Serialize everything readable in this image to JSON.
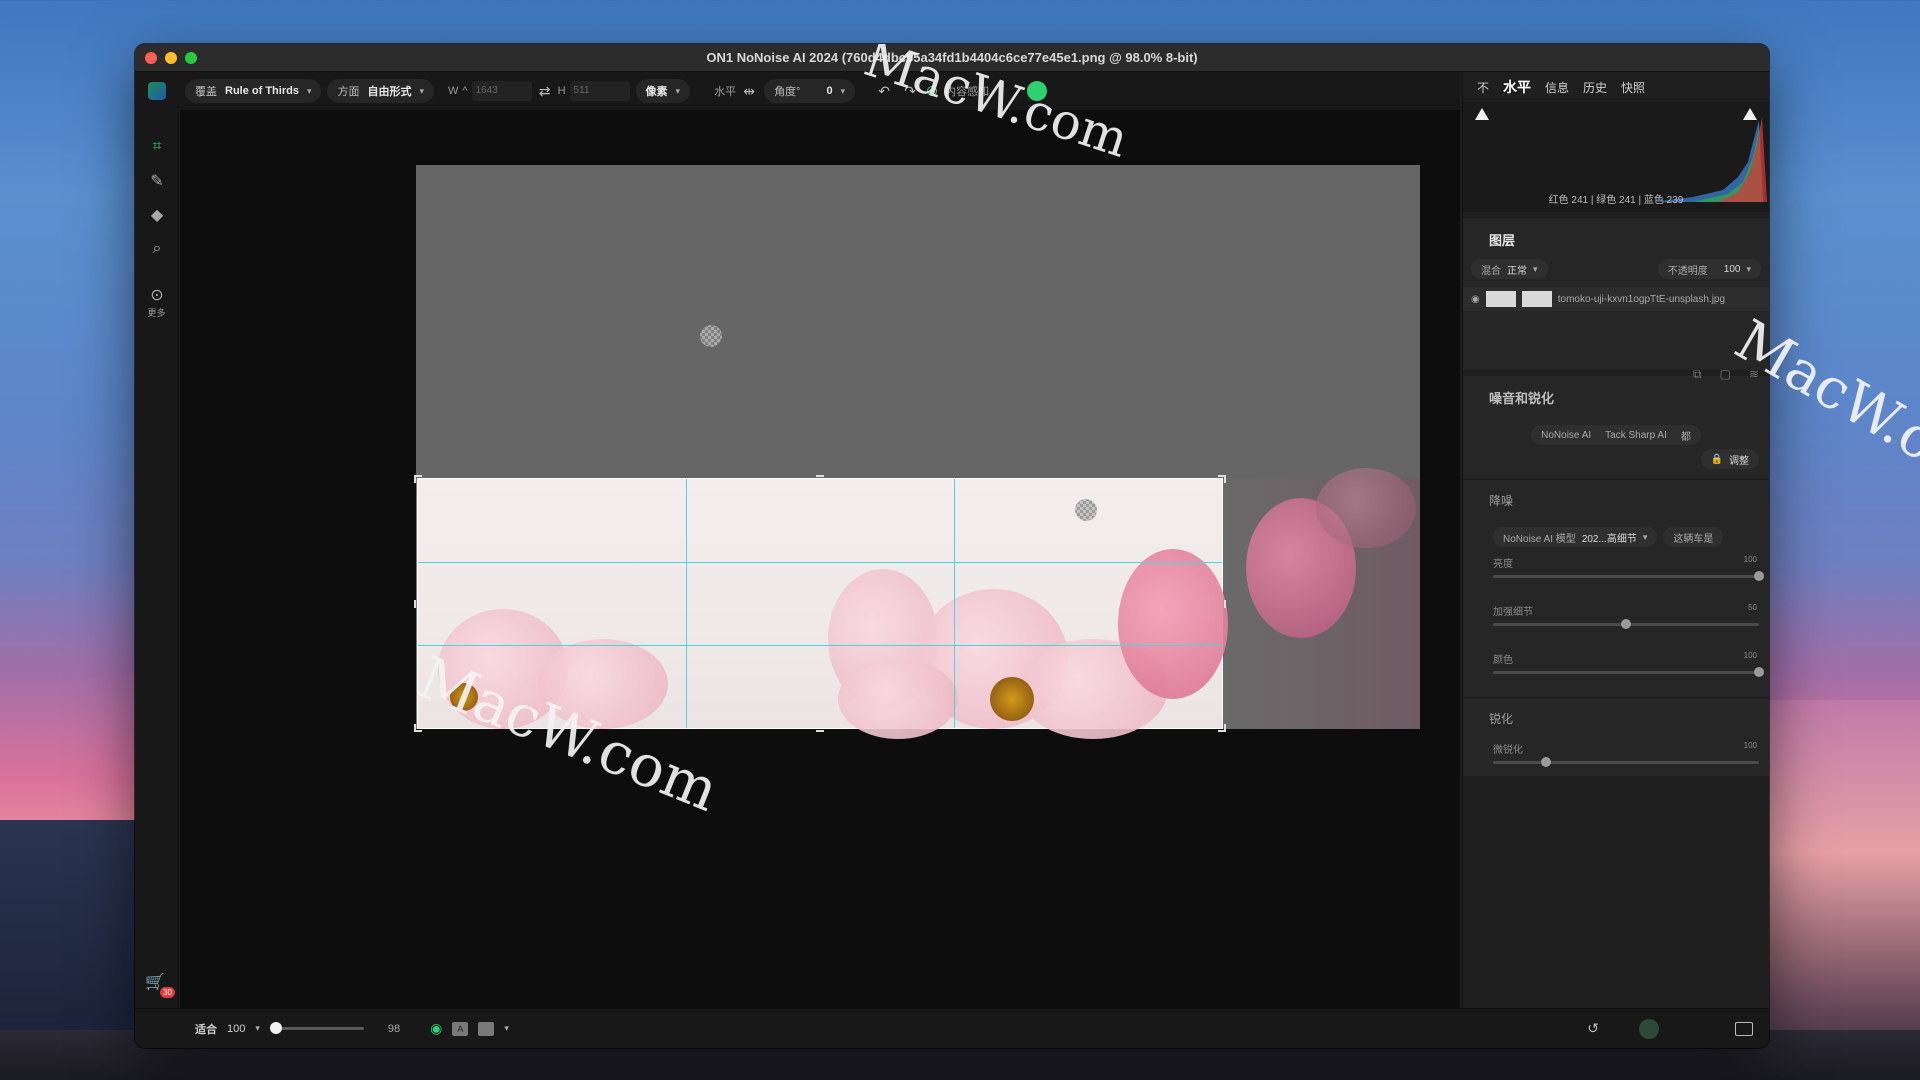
{
  "window": {
    "title": "ON1 NoNoise AI 2024 (760d4dbc55a34fd1b4404c6ce77e45e1.png @ 98.0% 8-bit)"
  },
  "toolbar": {
    "overlay_label": "覆盖",
    "overlay_value": "Rule of Thirds",
    "aspect_label": "方面",
    "aspect_value": "自由形式",
    "w_label": "W",
    "w_value": "1643",
    "h_label": "H",
    "h_value": "511",
    "unit_value": "像素",
    "level_label": "水平",
    "angle_label": "角度°",
    "angle_value": "0",
    "content_aware_label": "内容感知"
  },
  "left_tools": {
    "more_label": "更多",
    "cart_badge": "30"
  },
  "bottom": {
    "fit_label": "适合",
    "zoom_value": "100",
    "zoom_right_value": "98",
    "zoom_fraction": 0.0
  },
  "right_panel": {
    "tabs": [
      "不",
      "水平",
      "信息",
      "历史",
      "快照"
    ],
    "histogram_readout": "红色 241 | 绿色 241 | 蓝色 239",
    "layers": {
      "title": "图层",
      "blend_label": "混合",
      "blend_value": "正常",
      "opacity_label": "不透明度",
      "opacity_value": "100",
      "layer_name": "tomoko-uji-kxvn1ogpTtE-unsplash.jpg"
    },
    "noise": {
      "title": "噪音和锐化",
      "segment_a": "NoNoise AI",
      "segment_b": "Tack Sharp AI",
      "segment_c": "都",
      "adjust_label": "调整",
      "denoise_title": "降噪",
      "model_label": "NoNoise AI 模型",
      "model_value": "202...高细节",
      "model_right": "这辆车是",
      "sliders": [
        {
          "label": "亮度",
          "value": "100",
          "fraction": 1.0
        },
        {
          "label": "加强细节",
          "value": "50",
          "fraction": 0.5
        },
        {
          "label": "颜色",
          "value": "100",
          "fraction": 1.0
        }
      ],
      "sharpen_title": "锐化",
      "sharpen_slider": {
        "label": "微锐化",
        "value": "100",
        "fraction": 0.2
      }
    }
  },
  "watermark": "MacW.com",
  "colors": {
    "accent_green": "#2fcf72",
    "grid_cyan": "#48d6e0"
  }
}
